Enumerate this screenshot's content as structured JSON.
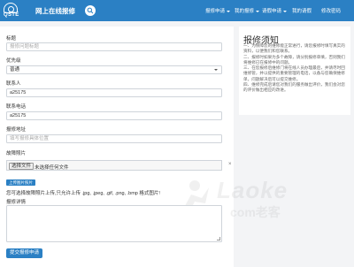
{
  "header": {
    "logo_text": "QSTE",
    "brand": "网上在线报修",
    "nav": [
      {
        "label": "报修申请",
        "caret": true
      },
      {
        "label": "我的报修",
        "caret": true
      },
      {
        "label": "请假申请",
        "caret": true
      },
      {
        "label": "我的请假",
        "caret": false
      },
      {
        "label": "修改密码",
        "caret": false
      }
    ]
  },
  "form": {
    "title_label": "标题",
    "title_placeholder": "报修问题标题",
    "priority_label": "优先级",
    "priority_value": "普通",
    "contact_label": "联系人",
    "contact_value": "a25175",
    "phone_label": "联系电话",
    "phone_value": "a25175",
    "address_label": "报修地址",
    "address_placeholder": "填写报修具体位置",
    "photo_label": "故障照片",
    "choose_file": "选择文件",
    "no_file": "未选择任何文件",
    "close_glyph": "×",
    "upload_button": "上传图片照片",
    "upload_hint": "您可选择故障照片上传,只允许上传 .jpg, .jpeg, .gif, .png, .bmp 格式图片!",
    "detail_label": "报修详情",
    "submit_button": "提交报修申请"
  },
  "notice": {
    "title": "报修须知",
    "lines": [
      "一、为保障您的维修能正常进行，请您报修时填写真实的资料，以便我们和您联系。",
      "二、报修时如果为多个故障，请分别报修单填，否则我们将维修已在报修中的问题。",
      "三、在您报修后维修门将在线人员办理最后，并请尽时回维修管，并以提供的重要管理的电话，以备与您确保维修单，问题解决后可以提交维修。",
      "四、维修完成后请您对我们的服务做出评价，我们会对您的评价做出相应的改进。"
    ]
  },
  "watermark": {
    "text": "Laoke",
    "sub": "com老客"
  }
}
